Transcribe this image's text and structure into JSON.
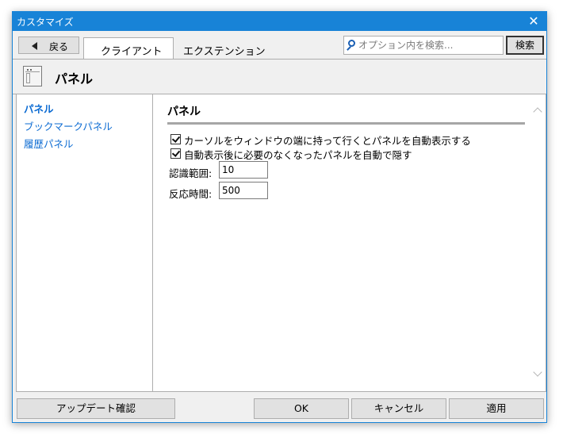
{
  "window": {
    "title": "カスタマイズ",
    "accent": "#1883d7"
  },
  "toolbar": {
    "back_label": "戻る",
    "tabs": [
      {
        "label": "クライアント",
        "active": true
      },
      {
        "label": "エクステンション",
        "active": false
      }
    ],
    "search": {
      "placeholder": "オプション内を検索...",
      "value": ""
    },
    "search_button": "検索"
  },
  "header": {
    "title": "パネル",
    "icon": "panel-window-icon"
  },
  "sidebar": {
    "items": [
      {
        "label": "パネル",
        "active": true
      },
      {
        "label": "ブックマークパネル",
        "active": false
      },
      {
        "label": "履歴パネル",
        "active": false
      }
    ]
  },
  "content": {
    "section_title": "パネル",
    "checkboxes": [
      {
        "label": "カーソルをウィンドウの端に持って行くとパネルを自動表示する",
        "checked": true
      },
      {
        "label": "自動表示後に必要のなくなったパネルを自動で隠す",
        "checked": true
      }
    ],
    "fields": [
      {
        "label": "認識範囲:",
        "value": "10"
      },
      {
        "label": "反応時間:",
        "value": "500"
      }
    ]
  },
  "footer": {
    "update_button": "アップデート確認",
    "ok_button": "OK",
    "cancel_button": "キャンセル",
    "apply_button": "適用"
  }
}
